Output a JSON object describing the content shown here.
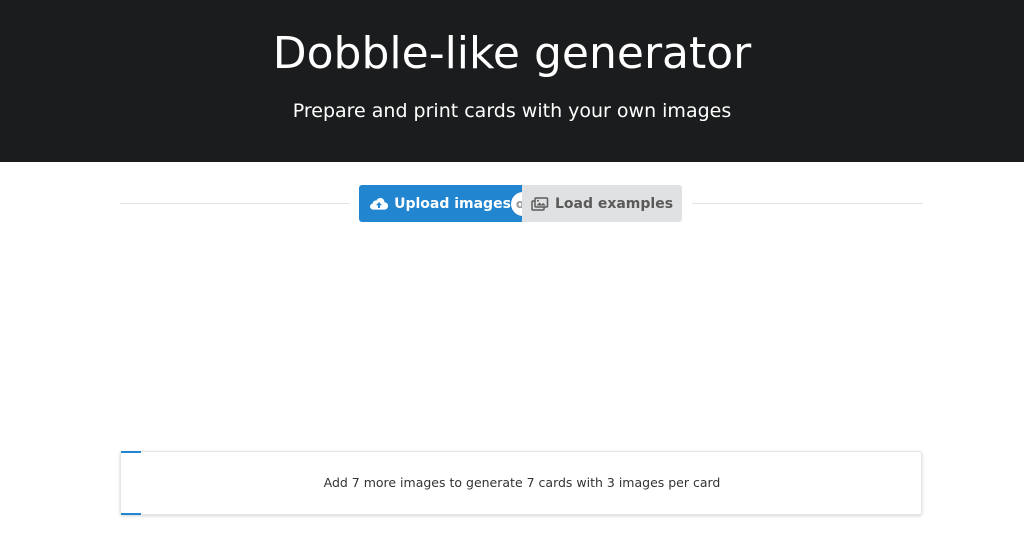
{
  "header": {
    "title": "Dobble-like generator",
    "subtitle": "Prepare and print cards with your own images"
  },
  "actions": {
    "upload_label": "Upload images",
    "or_label": "or",
    "examples_label": "Load examples",
    "upload_icon": "cloud-upload-icon",
    "examples_icon": "images-icon"
  },
  "status": {
    "message": "Add 7 more images to generate 7 cards with 3 images per card"
  },
  "colors": {
    "header_bg": "#1b1c1d",
    "primary": "#2185d0",
    "secondary_bg": "#e0e1e2"
  }
}
